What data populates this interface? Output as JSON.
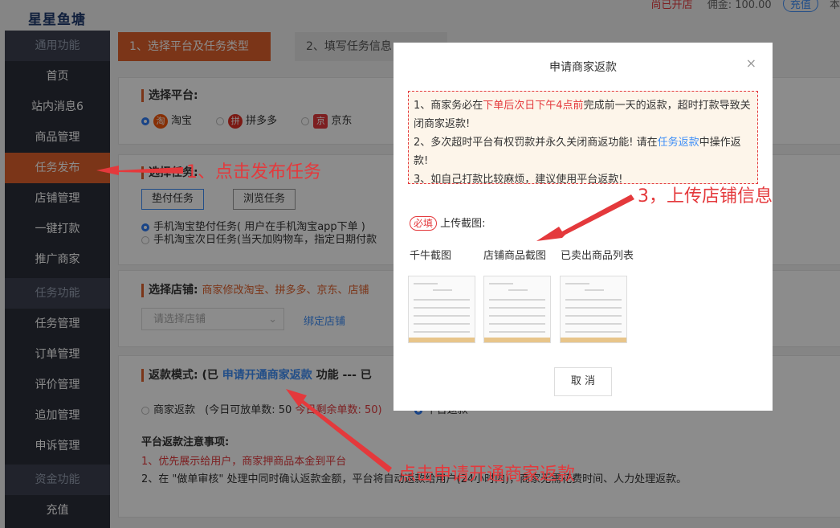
{
  "topbar": {
    "logo": "星星鱼塘",
    "open_status": "尚已开店",
    "balance_label": "佣金: 100.00",
    "recharge_label": "充值",
    "tail": "本"
  },
  "sidebar": {
    "items": [
      {
        "label": "通用功能",
        "type": "group"
      },
      {
        "label": "首页"
      },
      {
        "label": "站内消息6"
      },
      {
        "label": "商品管理"
      },
      {
        "label": "任务发布",
        "active": true
      },
      {
        "label": "店铺管理"
      },
      {
        "label": "一键打款"
      },
      {
        "label": "推广商家"
      },
      {
        "label": "任务功能",
        "type": "group"
      },
      {
        "label": "任务管理"
      },
      {
        "label": "订单管理"
      },
      {
        "label": "评价管理"
      },
      {
        "label": "追加管理"
      },
      {
        "label": "申诉管理"
      },
      {
        "label": "资金功能",
        "type": "group"
      },
      {
        "label": "充值"
      }
    ]
  },
  "steps": [
    "1、选择平台及任务类型",
    "2、填写任务信息"
  ],
  "platform": {
    "title": "选择平台:",
    "options": [
      {
        "label": "淘宝",
        "icon": "taobao-icon",
        "selected": true,
        "color": "#f5560a"
      },
      {
        "label": "拼多多",
        "icon": "pinduoduo-icon",
        "selected": false,
        "color": "#e02e24"
      },
      {
        "label": "京东",
        "icon": "jd-icon",
        "selected": false,
        "color": "#e4393c"
      }
    ]
  },
  "task": {
    "title": "选择任务:",
    "buttons": [
      "垫付任务",
      "浏览任务"
    ],
    "options": [
      "手机淘宝垫付任务( 用户在手机淘宝app下单 )",
      "手机淘宝次日任务(当天加购物车，指定日期付款"
    ]
  },
  "shop": {
    "title": "选择店铺:",
    "hint": "商家修改淘宝、拼多多、京东、店铺",
    "select_placeholder": "请选择店铺",
    "bind_link": "绑定店铺"
  },
  "refund": {
    "title_prefix": "返款模式: (已",
    "apply_link": "申请开通商家返款",
    "title_suffix": "功能 --- 已",
    "merchant_option": "商家返款",
    "quota": "(今日可放单数: 50",
    "remaining": "今日剩余单数: 50)",
    "platform_option": "平台返款",
    "notes_title": "平台返款注意事项:",
    "note1": "1、优先展示给用户，商家押商品本金到平台",
    "note2": "2、在 \"做单审核\" 处理中同时确认返款金额，平台将自动返款给用户(24小时内)，商家无需花费时间、人力处理返款。"
  },
  "modal": {
    "title": "申请商家返款",
    "close": "×",
    "n1_a": "1、商家务必在",
    "n1_red": "下单后次日下午4点前",
    "n1_b": "完成前一天的返款，超时打款导致关闭商家返款!",
    "n2_a": "2、多次超时平台有权罚款并永久关闭商返功能! 请在",
    "n2_link": "任务返款",
    "n2_b": "中操作返款!",
    "n3": "3、如自己打款比较麻烦，建议使用平台返款!",
    "required_tag": "必填",
    "upload_label": "上传截图:",
    "shots": [
      "千牛截图",
      "店铺商品截图",
      "已卖出商品列表"
    ],
    "cancel": "取 消"
  },
  "annotations": {
    "a1": "1、点击发布任务",
    "a2": "点击申请开通商家返款",
    "a3": "3，上传店铺信息"
  },
  "colors": {
    "accent": "#e0622c",
    "link": "#3e8ef7",
    "warning": "#e4393c",
    "sidebar": "#2b2f3a"
  }
}
